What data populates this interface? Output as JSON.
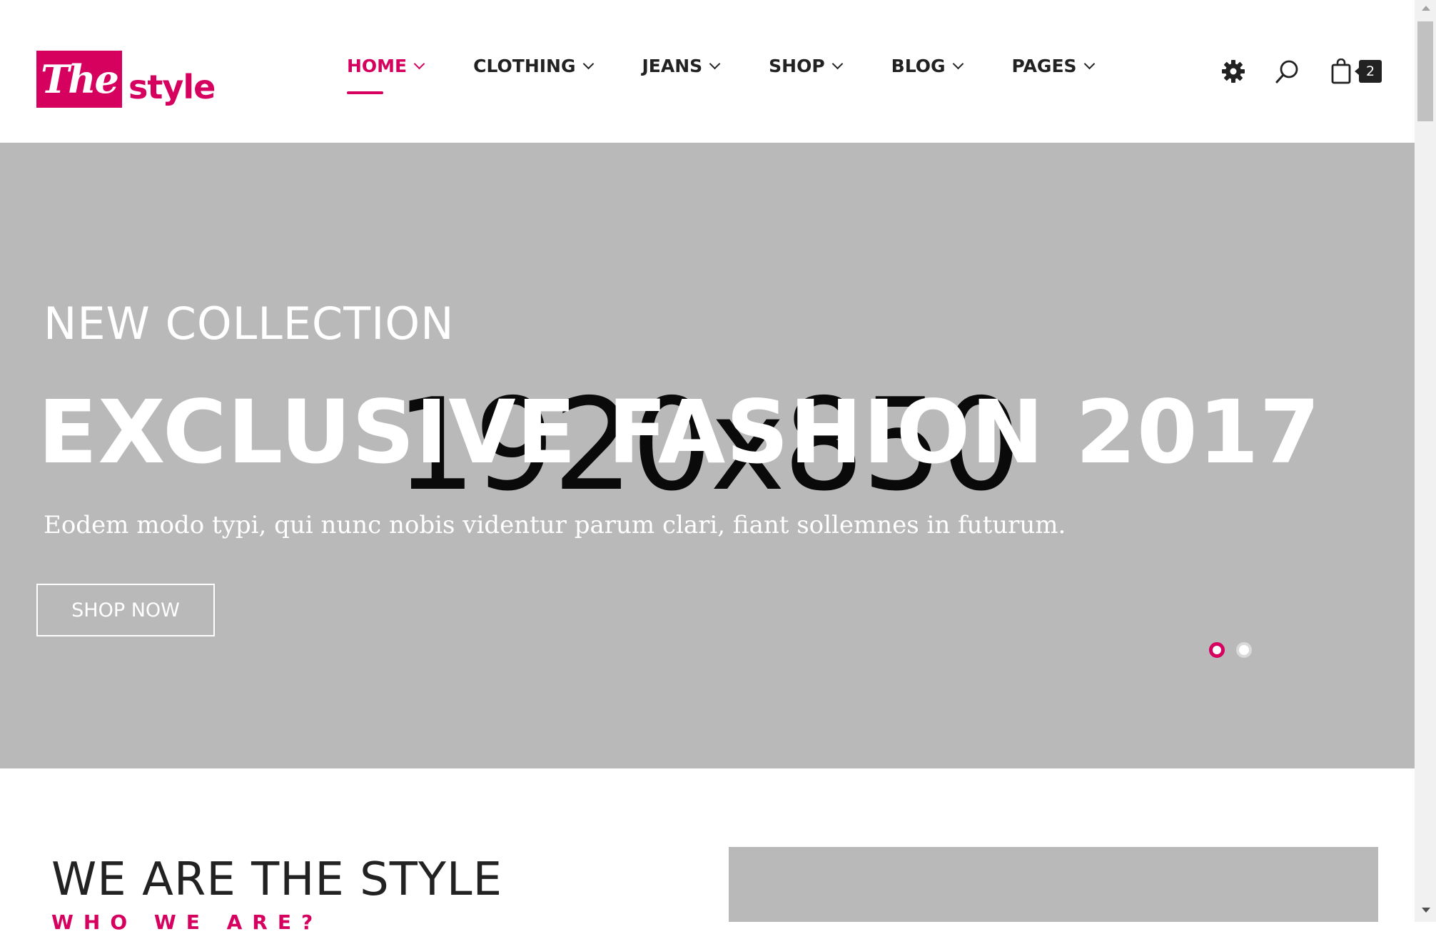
{
  "logo": {
    "box_text": "The",
    "word": "style"
  },
  "nav": {
    "items": [
      {
        "label": "HOME",
        "active": true
      },
      {
        "label": "CLOTHING",
        "active": false
      },
      {
        "label": "JEANS",
        "active": false
      },
      {
        "label": "SHOP",
        "active": false
      },
      {
        "label": "BLOG",
        "active": false
      },
      {
        "label": "PAGES",
        "active": false
      }
    ]
  },
  "header_icons": {
    "settings": "gear-icon",
    "search": "search-icon",
    "cart": "shopping-bag-icon"
  },
  "cart": {
    "count": "2"
  },
  "hero": {
    "placeholder": "1920x850",
    "subtitle": "NEW COLLECTION",
    "title": "EXCLUSIVE FASHION 2017",
    "text": "Eodem modo typi, qui nunc nobis videntur parum clari, fiant sollemnes in futurum.",
    "button": "SHOP NOW",
    "slides": 2,
    "active_slide": 1
  },
  "about": {
    "title": "WE ARE THE STYLE",
    "subtitle": "WHO WE ARE?"
  },
  "colors": {
    "accent": "#d6005f",
    "hero_bg": "#b9b9b9",
    "text": "#222222"
  }
}
